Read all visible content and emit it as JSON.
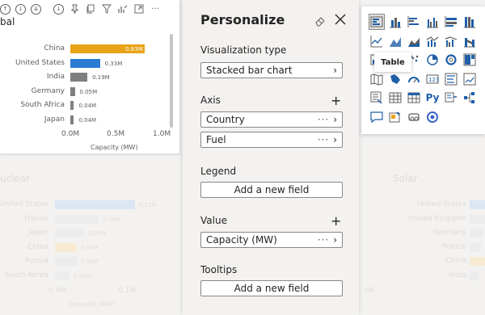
{
  "top_card": {
    "title": "bal",
    "categories": [
      "China",
      "United States",
      "India",
      "Germany",
      "South Africa",
      "Japan"
    ],
    "values": [
      0.83,
      0.33,
      0.19,
      0.05,
      0.04,
      0.04
    ],
    "value_labels": [
      "0.83M",
      "0.33M",
      "0.19M",
      "0.05M",
      "0.04M",
      "0.04M"
    ],
    "bar_colors": [
      "#e8a317",
      "#2b7bd3",
      "#7f7f7f",
      "#7f7f7f",
      "#7f7f7f",
      "#7f7f7f"
    ],
    "x_ticks": [
      "0.0M",
      "0.5M",
      "1.0M"
    ],
    "xlim": [
      0,
      1.0
    ],
    "x_title": "Capacity (MW)"
  },
  "bg_left": {
    "title": "uclear",
    "categories": [
      "United States",
      "France",
      "Japan",
      "China",
      "Russia",
      "South Korea"
    ],
    "values": [
      0.11,
      0.06,
      0.04,
      0.03,
      0.03,
      0.02
    ],
    "value_labels": [
      "0.11M",
      "0.06M",
      "0.04M",
      "0.03M",
      "0.03M",
      "0.02M"
    ],
    "x_ticks": [
      "0.0M",
      "0.1M"
    ],
    "x_title": "Capacity (MW)"
  },
  "bg_right": {
    "title": "Solar",
    "categories": [
      "United States",
      "United Kingdom",
      "Germany",
      "France",
      "China",
      "India"
    ]
  },
  "bg_center": {
    "x_tick": "0K"
  },
  "pane": {
    "title": "Personalize",
    "sections": {
      "viz_type_label": "Visualization type",
      "viz_type_value": "Stacked bar chart",
      "axis_label": "Axis",
      "axis_fields": [
        "Country",
        "Fuel"
      ],
      "legend_label": "Legend",
      "legend_add": "Add a new field",
      "value_label": "Value",
      "value_field": "Capacity (MW)",
      "tooltips_label": "Tooltips",
      "tooltips_add": "Add a new field"
    },
    "plus": "+",
    "dots": "···",
    "chevron": "›"
  },
  "gallery": {
    "tooltip": "Table",
    "icons": [
      "stacked-bar-chart",
      "stacked-column-chart",
      "clustered-bar-chart",
      "clustered-column-chart",
      "100-percent-bar-chart",
      "100-percent-column-chart",
      "line-chart",
      "area-chart",
      "stacked-area-chart",
      "line-and-column-chart",
      "line-and-clustered-column-chart",
      "ribbon-chart",
      "waterfall-chart",
      "funnel-chart",
      "scatter-chart",
      "pie-chart",
      "donut-chart",
      "treemap",
      "map",
      "filled-map",
      "gauge",
      "card",
      "multi-row-card",
      "kpi",
      "slicer",
      "table",
      "matrix",
      "python-visual",
      "key-influencers",
      "decomposition-tree",
      "qa-visual",
      "smart-narrative",
      "paginated-report",
      "power-apps"
    ],
    "python_label": "Py"
  },
  "colors": {
    "china_orange": "#e8a317",
    "us_blue": "#2b7bd3",
    "grey_bar": "#7f7f7f"
  }
}
